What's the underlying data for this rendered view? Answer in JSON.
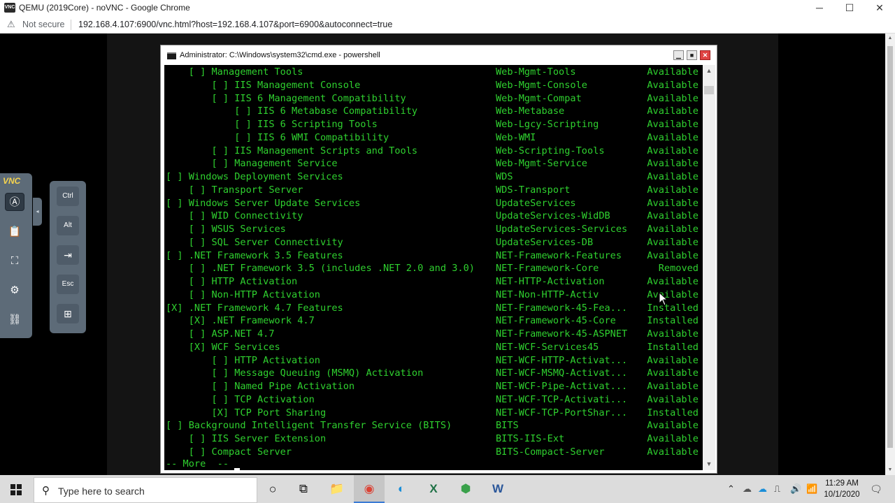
{
  "browser": {
    "title": "QEMU (2019Core) - noVNC - Google Chrome",
    "logo_text": "VNC",
    "security_label": "Not secure",
    "url": "192.168.4.107:6900/vnc.html?host=192.168.4.107&port=6900&autoconnect=true",
    "controls": {
      "minimize": "─",
      "maximize": "☐",
      "close": "✕"
    }
  },
  "novnc": {
    "brand": "VNC",
    "extra_keys": {
      "ctrl": "Ctrl",
      "alt": "Alt",
      "tab": "⇥",
      "esc": "Esc",
      "windows": "⊞"
    }
  },
  "cmd_window": {
    "title": "Administrator: C:\\Windows\\system32\\cmd.exe - powershell",
    "lines": [
      {
        "display": "    [ ] Management Tools",
        "name": "Web-Mgmt-Tools",
        "state": "Available"
      },
      {
        "display": "        [ ] IIS Management Console",
        "name": "Web-Mgmt-Console",
        "state": "Available"
      },
      {
        "display": "        [ ] IIS 6 Management Compatibility",
        "name": "Web-Mgmt-Compat",
        "state": "Available"
      },
      {
        "display": "            [ ] IIS 6 Metabase Compatibility",
        "name": "Web-Metabase",
        "state": "Available"
      },
      {
        "display": "            [ ] IIS 6 Scripting Tools",
        "name": "Web-Lgcy-Scripting",
        "state": "Available"
      },
      {
        "display": "            [ ] IIS 6 WMI Compatibility",
        "name": "Web-WMI",
        "state": "Available"
      },
      {
        "display": "        [ ] IIS Management Scripts and Tools",
        "name": "Web-Scripting-Tools",
        "state": "Available"
      },
      {
        "display": "        [ ] Management Service",
        "name": "Web-Mgmt-Service",
        "state": "Available"
      },
      {
        "display": "[ ] Windows Deployment Services",
        "name": "WDS",
        "state": "Available"
      },
      {
        "display": "    [ ] Transport Server",
        "name": "WDS-Transport",
        "state": "Available"
      },
      {
        "display": "[ ] Windows Server Update Services",
        "name": "UpdateServices",
        "state": "Available"
      },
      {
        "display": "    [ ] WID Connectivity",
        "name": "UpdateServices-WidDB",
        "state": "Available"
      },
      {
        "display": "    [ ] WSUS Services",
        "name": "UpdateServices-Services",
        "state": "Available"
      },
      {
        "display": "    [ ] SQL Server Connectivity",
        "name": "UpdateServices-DB",
        "state": "Available"
      },
      {
        "display": "[ ] .NET Framework 3.5 Features",
        "name": "NET-Framework-Features",
        "state": "Available"
      },
      {
        "display": "    [ ] .NET Framework 3.5 (includes .NET 2.0 and 3.0)",
        "name": "NET-Framework-Core",
        "state": "Removed"
      },
      {
        "display": "    [ ] HTTP Activation",
        "name": "NET-HTTP-Activation",
        "state": "Available"
      },
      {
        "display": "    [ ] Non-HTTP Activation",
        "name": "NET-Non-HTTP-Activ",
        "state": "Available"
      },
      {
        "display": "[X] .NET Framework 4.7 Features",
        "name": "NET-Framework-45-Fea...",
        "state": "Installed"
      },
      {
        "display": "    [X] .NET Framework 4.7",
        "name": "NET-Framework-45-Core",
        "state": "Installed"
      },
      {
        "display": "    [ ] ASP.NET 4.7",
        "name": "NET-Framework-45-ASPNET",
        "state": "Available"
      },
      {
        "display": "    [X] WCF Services",
        "name": "NET-WCF-Services45",
        "state": "Installed"
      },
      {
        "display": "        [ ] HTTP Activation",
        "name": "NET-WCF-HTTP-Activat...",
        "state": "Available"
      },
      {
        "display": "        [ ] Message Queuing (MSMQ) Activation",
        "name": "NET-WCF-MSMQ-Activat...",
        "state": "Available"
      },
      {
        "display": "        [ ] Named Pipe Activation",
        "name": "NET-WCF-Pipe-Activat...",
        "state": "Available"
      },
      {
        "display": "        [ ] TCP Activation",
        "name": "NET-WCF-TCP-Activati...",
        "state": "Available"
      },
      {
        "display": "        [X] TCP Port Sharing",
        "name": "NET-WCF-TCP-PortShar...",
        "state": "Installed"
      },
      {
        "display": "[ ] Background Intelligent Transfer Service (BITS)",
        "name": "BITS",
        "state": "Available"
      },
      {
        "display": "    [ ] IIS Server Extension",
        "name": "BITS-IIS-Ext",
        "state": "Available"
      },
      {
        "display": "    [ ] Compact Server",
        "name": "BITS-Compact-Server",
        "state": "Available"
      }
    ],
    "more_prompt": "-- More  --"
  },
  "taskbar": {
    "search_placeholder": "Type here to search",
    "time": "11:29 AM",
    "date": "10/1/2020"
  }
}
